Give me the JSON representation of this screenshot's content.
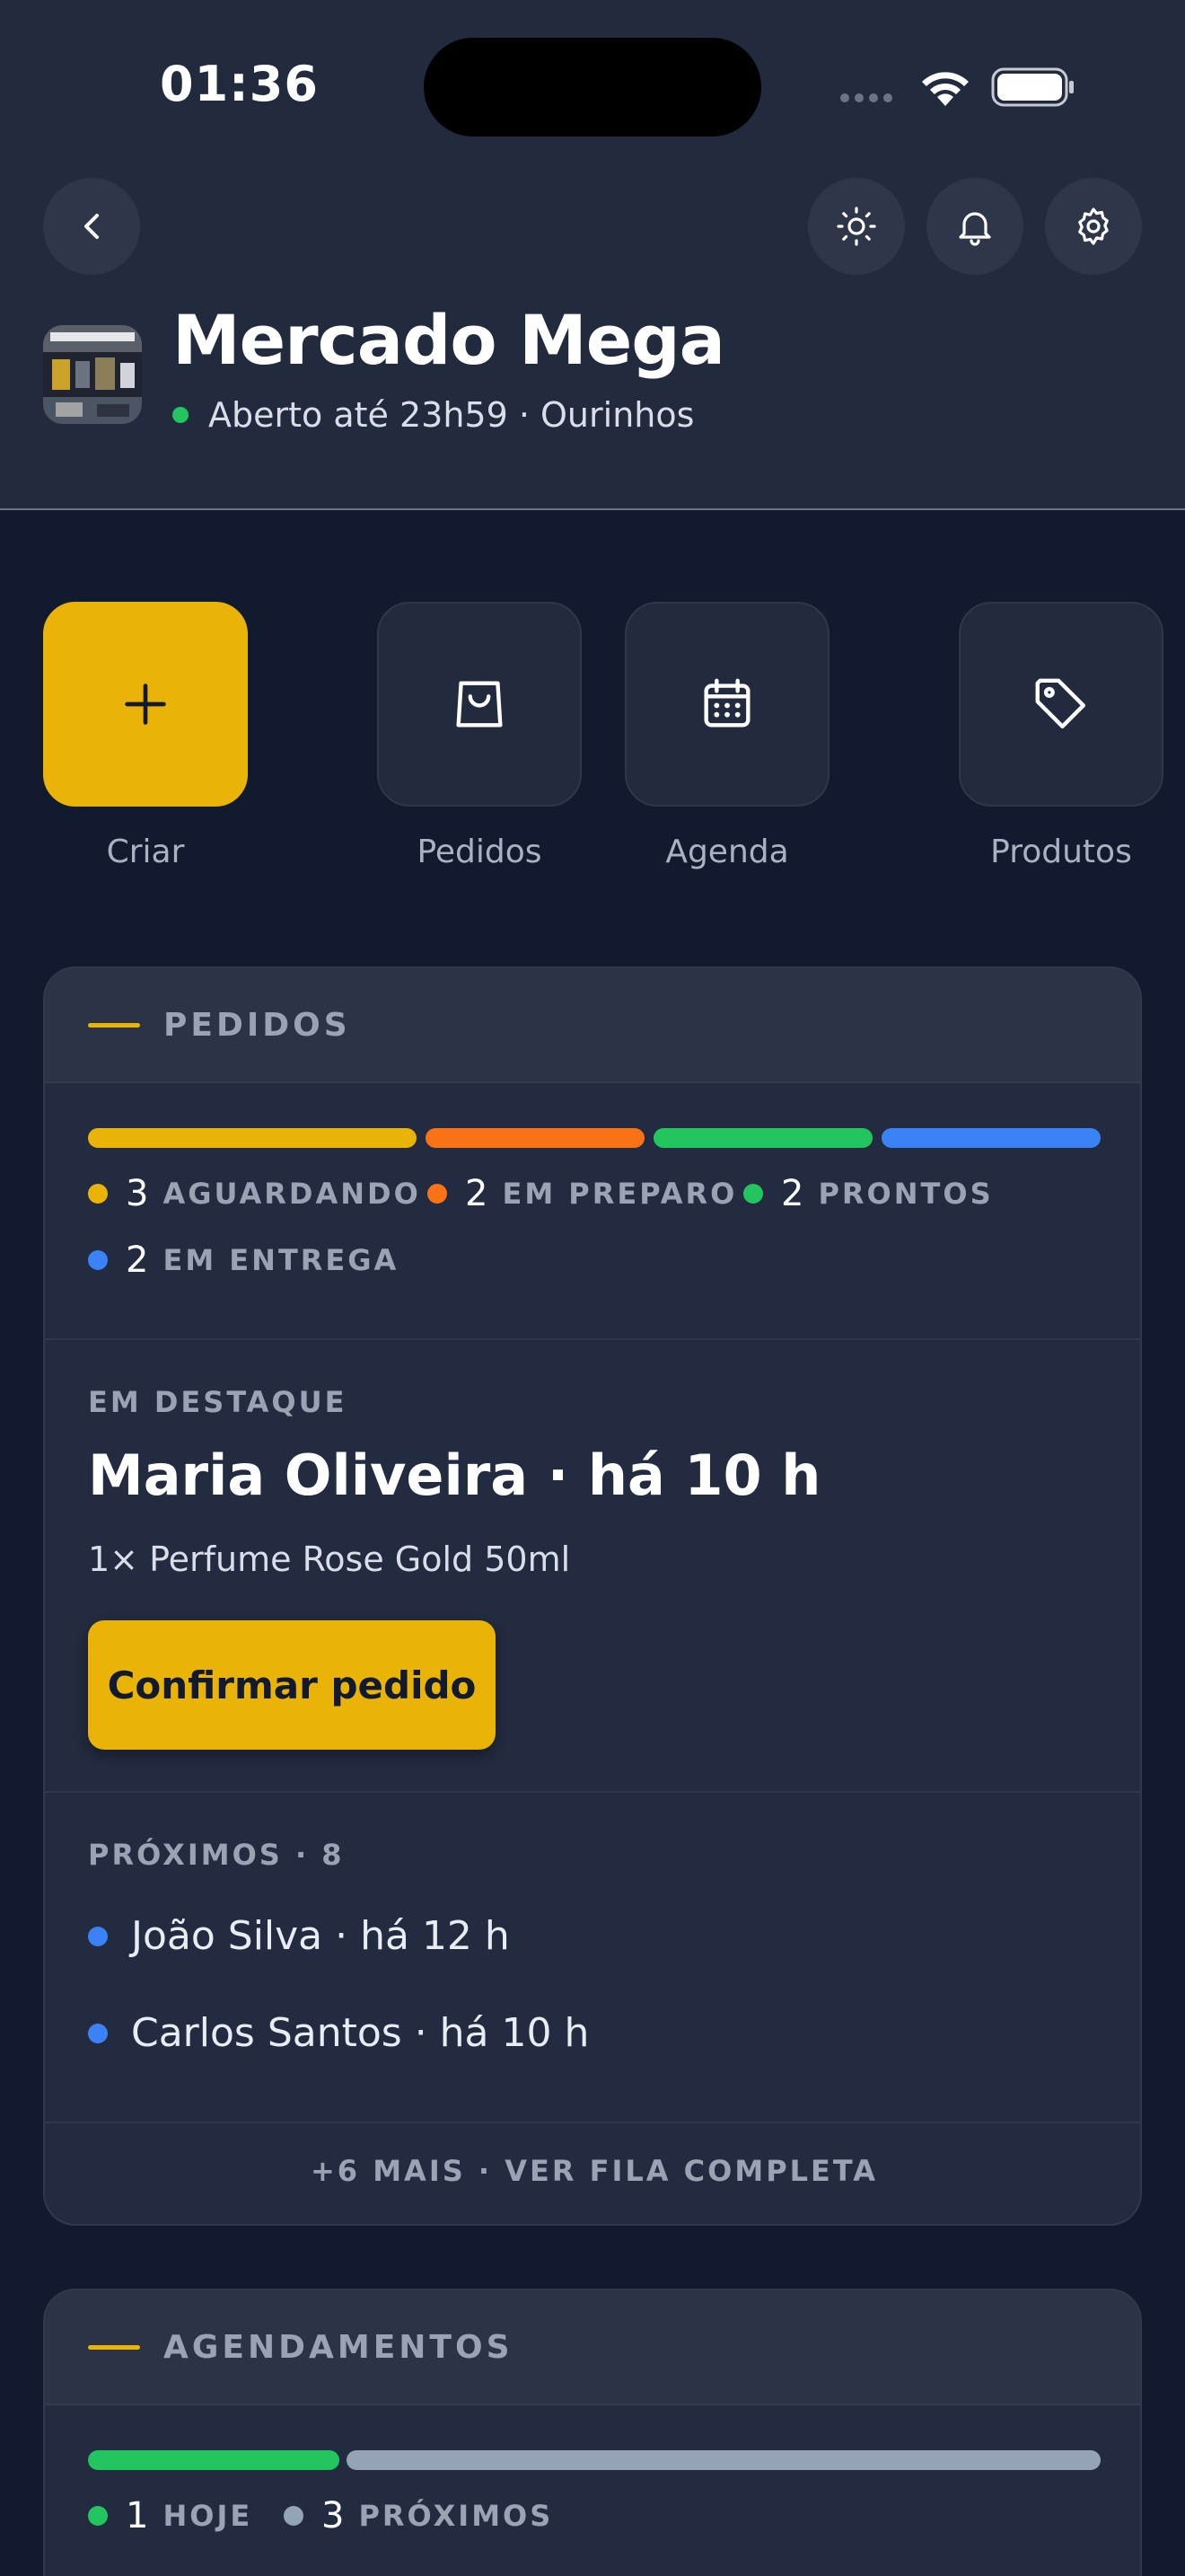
{
  "status_bar": {
    "time": "01:36"
  },
  "header": {
    "store_name": "Mercado Mega",
    "store_status": "Aberto até 23h59 · Ourinhos",
    "icons": [
      "back-icon",
      "sun-icon",
      "bell-icon",
      "gear-icon"
    ]
  },
  "quick_actions": [
    {
      "label": "Criar",
      "icon": "plus-icon"
    },
    {
      "label": "Pedidos",
      "icon": "shopping-bag-icon"
    },
    {
      "label": "Agenda",
      "icon": "calendar-icon"
    },
    {
      "label": "Produtos",
      "icon": "tag-icon"
    }
  ],
  "orders": {
    "title": "PEDIDOS",
    "legend": [
      {
        "count": "3",
        "label": "AGUARDANDO",
        "color": "#eab308"
      },
      {
        "count": "2",
        "label": "EM PREPARO",
        "color": "#f97316"
      },
      {
        "count": "2",
        "label": "PRONTOS",
        "color": "#22c55e"
      },
      {
        "count": "2",
        "label": "EM ENTREGA",
        "color": "#3b82f6"
      }
    ],
    "featured": {
      "eyebrow": "EM DESTAQUE",
      "title": "Maria Oliveira · há 10 h",
      "item": "1× Perfume Rose Gold 50ml",
      "button": "Confirmar pedido"
    },
    "next": {
      "title": "PRÓXIMOS · 8",
      "items": [
        {
          "text": "João Silva · há 12 h"
        },
        {
          "text": "Carlos Santos · há 10 h"
        }
      ]
    },
    "more_link": "+6 MAIS · VER FILA COMPLETA"
  },
  "appointments": {
    "title": "AGENDAMENTOS",
    "legend": [
      {
        "count": "1",
        "label": "HOJE",
        "color": "#22c55e"
      },
      {
        "count": "3",
        "label": "PRÓXIMOS",
        "color": "#94a3b8"
      }
    ]
  }
}
